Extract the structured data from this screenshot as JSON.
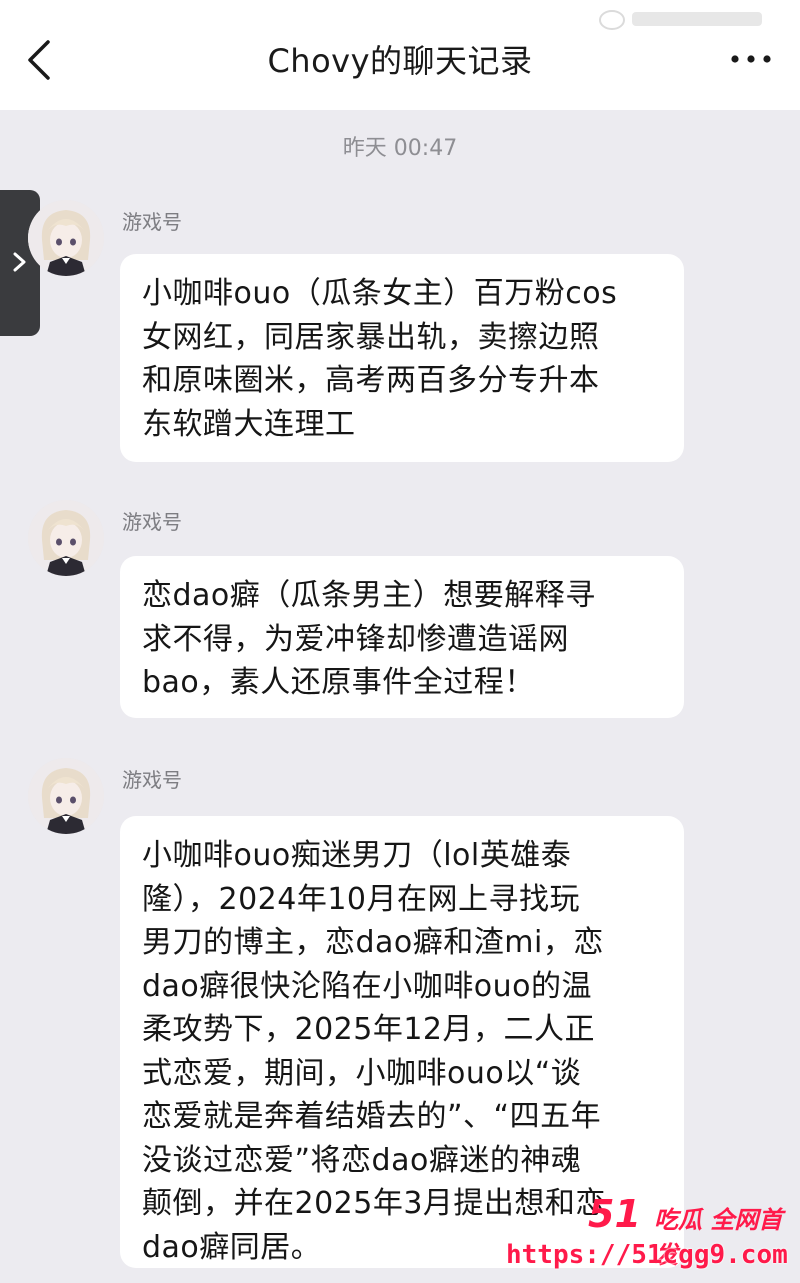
{
  "header": {
    "title": "Chovy的聊天记录"
  },
  "timestamp": "昨天 00:47",
  "messages": [
    {
      "sender": "游戏号",
      "text": "小咖啡ouo（瓜条女主）百万粉cos\n女网红，同居家暴出轨，卖擦边照\n和原味圈米，高考两百多分专升本\n东软蹭大连理工"
    },
    {
      "sender": "游戏号",
      "text": "恋dao癖（瓜条男主）想要解释寻\n求不得，为爱冲锋却惨遭造谣网\nbao，素人还原事件全过程！"
    },
    {
      "sender": "游戏号",
      "text": "小咖啡ouo痴迷男刀（lol英雄泰\n隆），2024年10月在网上寻找玩\n男刀的博主，恋dao癖和渣mi，恋\ndao癖很快沦陷在小咖啡ouo的温\n柔攻势下，2025年12月，二人正\n式恋爱，期间，小咖啡ouo以“谈\n恋爱就是奔着结婚去的”、“四五年\n没谈过恋爱”将恋dao癖迷的神魂\n颠倒，并在2025年3月提出想和恋\ndao癖同居。"
    }
  ],
  "watermark": {
    "brand_number": "51",
    "brand_text": "吃瓜 全网首发",
    "url": "https://51cgg9.com"
  },
  "colors": {
    "background": "#ecebf0",
    "bubble": "#ffffff",
    "watermark": "#ff1a4a"
  }
}
